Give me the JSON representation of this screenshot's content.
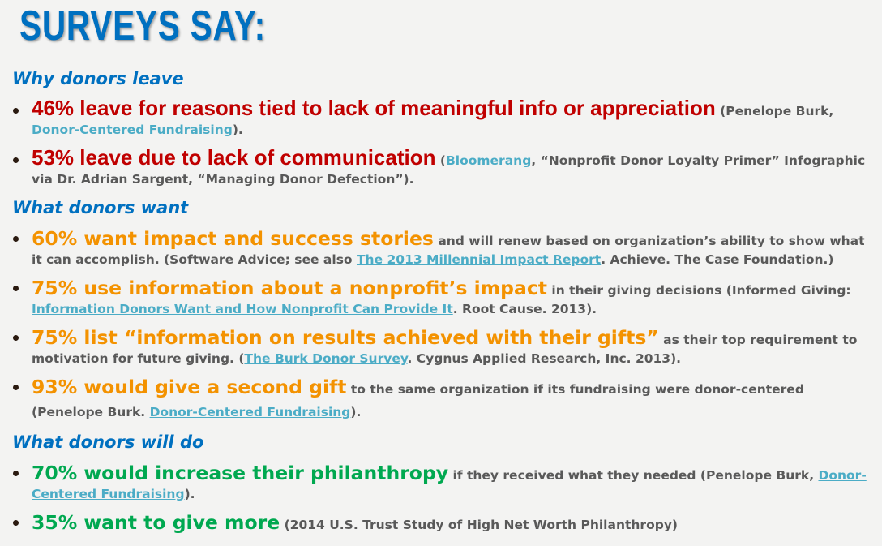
{
  "title": "SURVEYS SAY:",
  "colors": {
    "heading": "#0070c0",
    "leave": "#c00000",
    "want": "#f39200",
    "will_do": "#00a850",
    "body": "#595959",
    "link": "#4bacc6",
    "background": "#f3f3f2"
  },
  "sections": [
    {
      "heading": "Why donors leave",
      "items": [
        {
          "lead": "46% leave for reasons tied to lack of meaningful info or appreciation",
          "pre": " (Penelope Burk, ",
          "link": "Donor-Centered Fundraising",
          "post": ")."
        },
        {
          "lead": "53% leave due to lack of communication",
          "pre": " (",
          "link": "Bloomerang",
          "post": ", “Nonprofit Donor Loyalty Primer” Infographic via Dr. Adrian Sargent, “Managing Donor Defection”)."
        }
      ]
    },
    {
      "heading": "What donors want",
      "items": [
        {
          "lead": "60% want impact and success stories",
          "pre": " and will renew based on organization’s ability to show what it can accomplish. (Software Advice; see also ",
          "link": "The 2013 Millennial Impact Report",
          "post": ". Achieve. The Case Foundation.)"
        },
        {
          "lead": "75% use information about a nonprofit’s impact",
          "pre": " in their giving decisions (Informed Giving: ",
          "link": "Information Donors Want and How Nonprofit Can Provide It",
          "post": ". Root Cause. 2013)."
        },
        {
          "lead": "75% list “information on results achieved with their gifts”",
          "pre": " as their top requirement to motivation for future giving. (",
          "link": "The Burk Donor Survey",
          "post": ". Cygnus Applied Research, Inc. 2013)."
        },
        {
          "lead": "93% would give a second gift",
          "pre": " to the same organization if its fundraising were donor-centered (Penelope Burk. ",
          "link": "Donor-Centered Fundraising",
          "post": ")."
        }
      ]
    },
    {
      "heading": "What donors will do",
      "items": [
        {
          "lead": "70% would increase their philanthropy",
          "pre": " if they received what they needed (Penelope Burk, ",
          "link": "Donor-Centered Fundraising",
          "post": ")."
        },
        {
          "lead": "35% want to give more",
          "pre": " (2014 U.S. Trust Study of High Net Worth Philanthropy)",
          "link": null,
          "post": ""
        }
      ]
    }
  ]
}
